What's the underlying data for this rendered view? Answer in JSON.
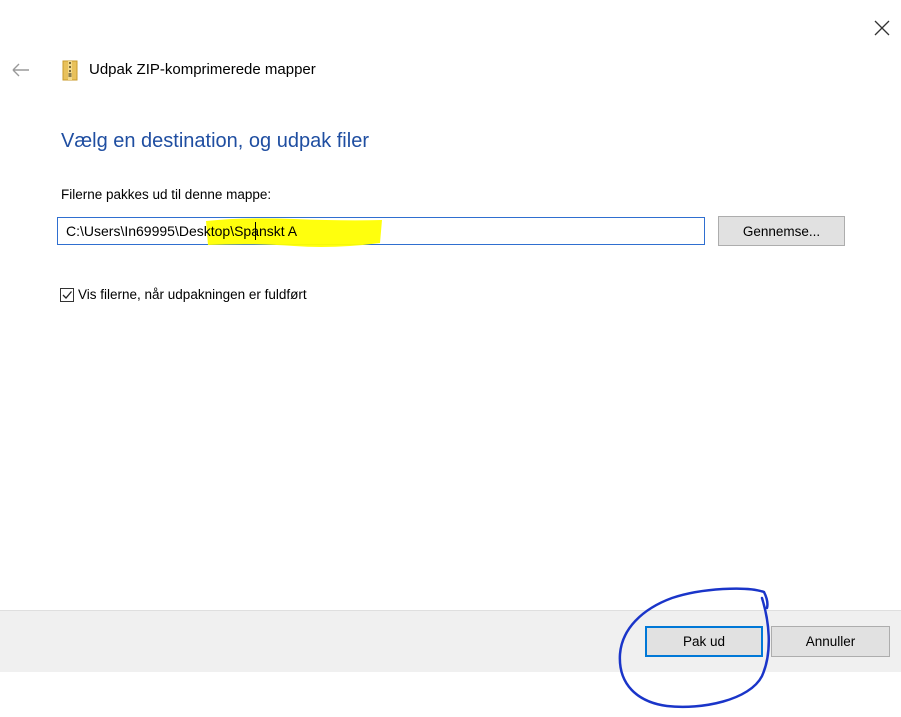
{
  "window": {
    "title": "Udpak ZIP-komprimerede mapper",
    "close_icon": "close-icon",
    "back_icon": "back-arrow-icon",
    "folder_icon": "zip-folder-icon"
  },
  "main": {
    "heading": "Vælg en destination, og udpak filer",
    "field_label": "Filerne pakkes ud til denne mappe:",
    "path_value": "C:\\Users\\In69995\\Desktop\\Spanskt A",
    "browse_label": "Gennemse...",
    "checkbox_label": "Vis filerne, når udpakningen er fuldført",
    "checkbox_checked": true
  },
  "footer": {
    "extract_label": "Pak ud",
    "cancel_label": "Annuller"
  },
  "colors": {
    "heading": "#1f4ea1",
    "input_border": "#2f6fd0",
    "highlight": "#ffff00",
    "annotation": "#1a35c9",
    "footer_bg": "#f0f0f0"
  }
}
